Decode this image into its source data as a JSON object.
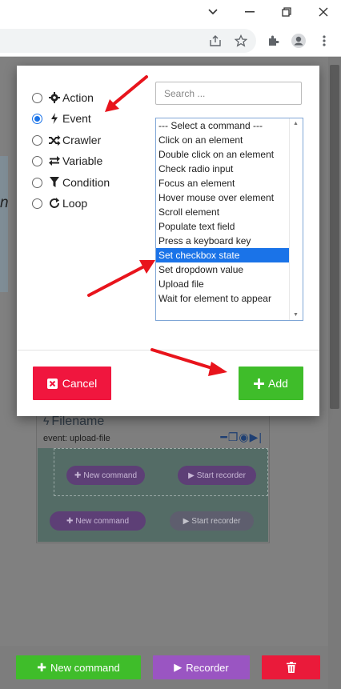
{
  "browser": {
    "window_controls": {
      "chevron": "⌄",
      "minimize": "—",
      "restore": "❐",
      "close": "✕"
    },
    "toolbar_icons": [
      "share-icon",
      "star-icon",
      "extensions-icon",
      "profile-icon",
      "menu-icon"
    ]
  },
  "page": {
    "left_text": "n",
    "card": {
      "title": "Filename",
      "subtitle": "event: upload-file",
      "inner_new_command": "New command",
      "inner_start_recorder": "Start recorder",
      "outer_new_command": "New command",
      "outer_start_recorder": "Start recorder"
    },
    "bottom_bar": {
      "new_command": "New command",
      "recorder": "Recorder"
    }
  },
  "modal": {
    "types": [
      {
        "label": "Action",
        "icon": "gear-icon",
        "checked": false
      },
      {
        "label": "Event",
        "icon": "bolt-icon",
        "checked": true
      },
      {
        "label": "Crawler",
        "icon": "shuffle-icon",
        "checked": false
      },
      {
        "label": "Variable",
        "icon": "exchange-icon",
        "checked": false
      },
      {
        "label": "Condition",
        "icon": "filter-icon",
        "checked": false
      },
      {
        "label": "Loop",
        "icon": "refresh-icon",
        "checked": false
      }
    ],
    "search_placeholder": "Search ...",
    "commands": [
      "--- Select a command ---",
      "Click on an element",
      "Double click on an element",
      "Check radio input",
      "Focus an element",
      "Hover mouse over element",
      "Scroll element",
      "Populate text field",
      "Press a keyboard key",
      "Set checkbox state",
      "Set dropdown value",
      "Upload file",
      "Wait for element to appear"
    ],
    "selected_command": "Set checkbox state",
    "cancel_label": "Cancel",
    "add_label": "Add"
  },
  "colors": {
    "accent_blue": "#1a73e8",
    "cancel_red": "#f0163e",
    "add_green": "#3fbd2a",
    "recorder_purple": "#9a55c2",
    "annotation_arrow": "#e8141c"
  }
}
